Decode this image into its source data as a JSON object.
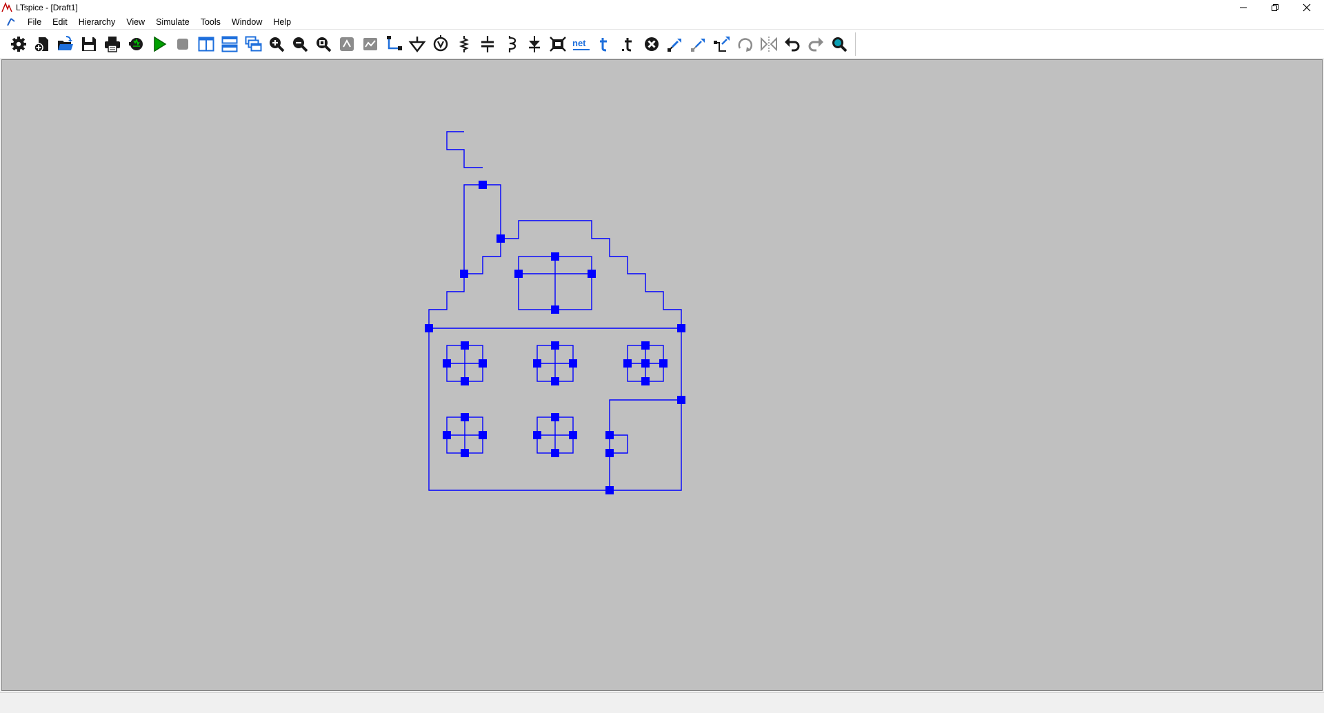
{
  "window": {
    "title": "LTspice - [Draft1]",
    "controls": [
      "minimize",
      "restore",
      "close"
    ]
  },
  "menu": {
    "items": [
      "File",
      "Edit",
      "Hierarchy",
      "View",
      "Simulate",
      "Tools",
      "Window",
      "Help"
    ]
  },
  "toolbar": {
    "buttons": [
      {
        "id": "settings",
        "icon": "gear-icon"
      },
      {
        "id": "new-schematic",
        "icon": "new-schematic-icon"
      },
      {
        "id": "open",
        "icon": "open-folder-icon"
      },
      {
        "id": "save",
        "icon": "save-icon"
      },
      {
        "id": "print",
        "icon": "print-icon"
      },
      {
        "id": "control-panel",
        "icon": "hammer-icon"
      },
      {
        "id": "run",
        "icon": "run-icon"
      },
      {
        "id": "halt",
        "icon": "halt-icon"
      },
      {
        "id": "tile-vertical",
        "icon": "tile-vertical-icon"
      },
      {
        "id": "tile-horizontal",
        "icon": "tile-horizontal-icon"
      },
      {
        "id": "cascade",
        "icon": "cascade-icon"
      },
      {
        "id": "zoom-in",
        "icon": "zoom-in-icon"
      },
      {
        "id": "zoom-out",
        "icon": "zoom-out-icon"
      },
      {
        "id": "zoom-fit",
        "icon": "zoom-fit-icon"
      },
      {
        "id": "pan",
        "icon": "pan-icon"
      },
      {
        "id": "autorange",
        "icon": "autorange-icon"
      },
      {
        "id": "wire",
        "icon": "wire-icon"
      },
      {
        "id": "ground",
        "icon": "ground-icon"
      },
      {
        "id": "voltage-source",
        "icon": "voltage-source-icon"
      },
      {
        "id": "resistor",
        "icon": "resistor-icon"
      },
      {
        "id": "capacitor",
        "icon": "capacitor-icon"
      },
      {
        "id": "inductor",
        "icon": "inductor-icon"
      },
      {
        "id": "diode",
        "icon": "diode-icon"
      },
      {
        "id": "component",
        "icon": "component-icon"
      },
      {
        "id": "net-label",
        "icon": "net-label-icon",
        "label": "net"
      },
      {
        "id": "text",
        "icon": "text-icon"
      },
      {
        "id": "spice-directive",
        "icon": "spice-directive-icon"
      },
      {
        "id": "delete",
        "icon": "delete-icon"
      },
      {
        "id": "duplicate",
        "icon": "duplicate-icon"
      },
      {
        "id": "move",
        "icon": "move-icon"
      },
      {
        "id": "drag",
        "icon": "drag-icon"
      },
      {
        "id": "rotate",
        "icon": "rotate-icon"
      },
      {
        "id": "mirror",
        "icon": "mirror-icon"
      },
      {
        "id": "undo",
        "icon": "undo-icon"
      },
      {
        "id": "redo",
        "icon": "redo-icon"
      },
      {
        "id": "find",
        "icon": "find-icon"
      }
    ]
  },
  "schematic": {
    "wire_color": "#0000ff",
    "background": "#c0c0c0"
  },
  "colors": {
    "run_green": "#00a000",
    "toolbar_dark": "#1a1a1a",
    "toolbar_disabled": "#8c8c8c"
  }
}
